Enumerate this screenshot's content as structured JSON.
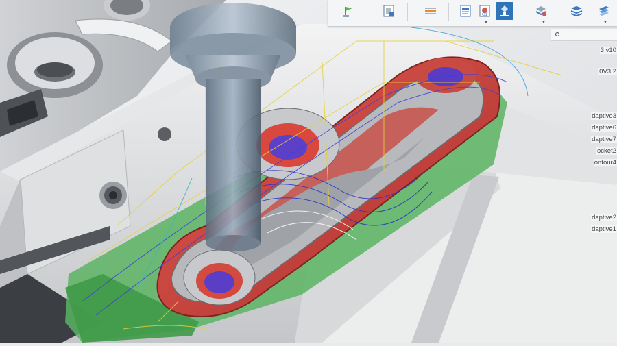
{
  "browser": {
    "items": [
      {
        "label": "3 v10"
      },
      {
        "label": "0V3:2"
      },
      {
        "label": "daptive3"
      },
      {
        "label": "daptive6"
      },
      {
        "label": "daptive7"
      },
      {
        "label": "ocket2"
      },
      {
        "label": "ontour4"
      },
      {
        "label": "daptive2"
      },
      {
        "label": "daptive1"
      }
    ]
  },
  "toolbar": {
    "buttons": [
      {
        "icon": "flag-pin-icon"
      },
      {
        "icon": "setup-sheet-icon"
      },
      {
        "icon": "ruler-icon"
      },
      {
        "icon": "nc-program-icon"
      },
      {
        "icon": "tool-library-icon"
      },
      {
        "icon": "simulate-icon",
        "active": true
      },
      {
        "icon": "post-process-icon"
      },
      {
        "icon": "layers-icon"
      },
      {
        "icon": "stack-icon"
      }
    ]
  },
  "colors": {
    "accent": "#2f73b8",
    "stock": "#c8413b",
    "fixture_green": "#4caa55",
    "toolpath_blue": "#3a3fd8",
    "toolpath_yellow": "#e8d23a"
  }
}
